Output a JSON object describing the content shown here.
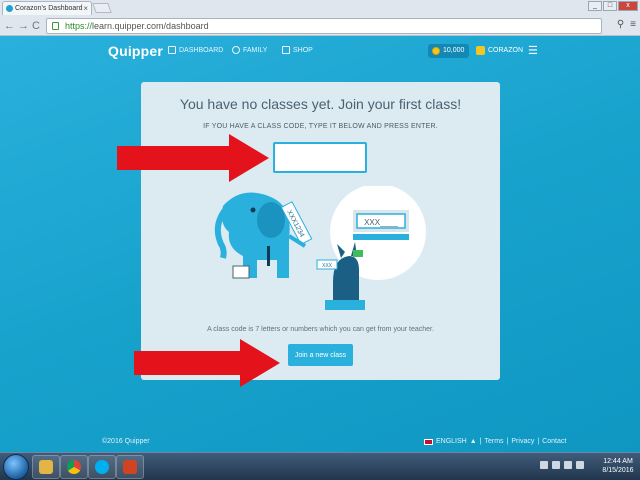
{
  "browser": {
    "tab_title": "Corazon's Dashboard",
    "tab_close": "×",
    "window_buttons": [
      "_",
      "□",
      "x"
    ],
    "url_scheme": "https://",
    "url_rest": "learn.quipper.com/dashboard",
    "back": "←",
    "forward": "→",
    "reload": "C"
  },
  "nav": {
    "logo": "Quipper",
    "items": [
      {
        "label": "DASHBOARD"
      },
      {
        "label": "FAMILY"
      },
      {
        "label": "SHOP"
      }
    ],
    "coins": "10,000",
    "user": "CORAZON",
    "menu": "☰"
  },
  "card": {
    "title": "You have no classes yet. Join your first class!",
    "subtitle": "IF YOU HAVE A CLASS CODE, TYPE IT BELOW AND PRESS ENTER.",
    "input_value": "",
    "illustration": {
      "sign_text": "XXX1234",
      "speech_text": "XXX____",
      "card_text": "XXX"
    },
    "help": "A class code is 7 letters or numbers which you can get from your teacher.",
    "join_button": "Join a new class"
  },
  "footer": {
    "copyright": "©2016 Quipper",
    "language": "ENGLISH",
    "caret": "▲",
    "links": [
      "Terms",
      "Privacy",
      "Contact"
    ],
    "sep": "|"
  },
  "taskbar": {
    "time": "12:44 AM",
    "date": "8/15/2016"
  },
  "colors": {
    "brand": "#1aa3cf",
    "arrow": "#e3121b",
    "card": "#dcebf2"
  }
}
